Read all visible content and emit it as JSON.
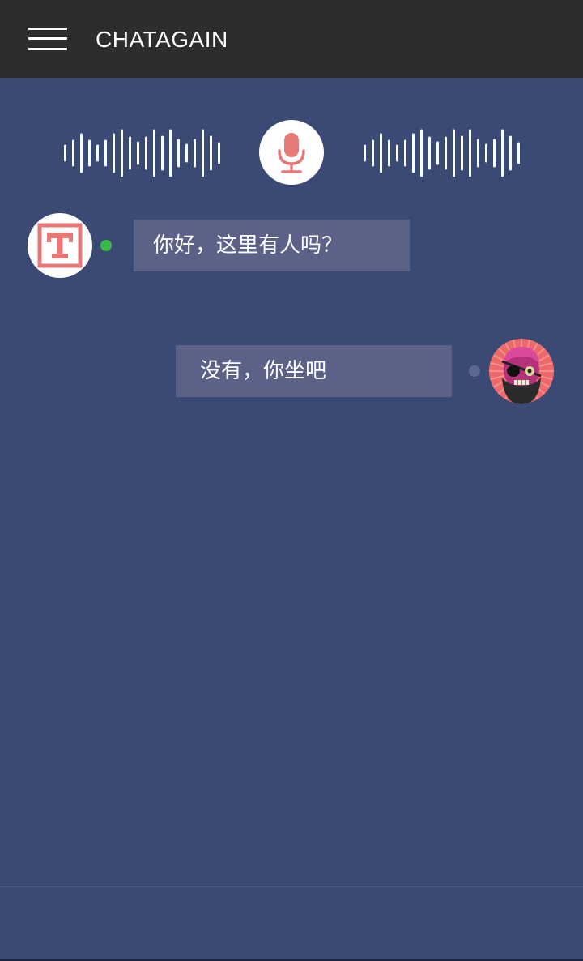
{
  "header": {
    "title": "CHATAGAIN",
    "menu_icon": "hamburger-menu-icon"
  },
  "voice": {
    "mic_icon": "microphone-icon",
    "wave_icon": "sound-wave-icon",
    "accent_color": "#e87878"
  },
  "messages": [
    {
      "side": "left",
      "text": "你好，这里有人吗？",
      "avatar": "typo-logo-avatar",
      "status": "online",
      "status_color": "#3cb84a"
    },
    {
      "side": "right",
      "text": "没有，你坐吧",
      "avatar": "pirate-avatar",
      "status": "offline",
      "status_color": "#5d6790"
    }
  ],
  "colors": {
    "background": "#3a4a74",
    "header": "#2d2d2d",
    "bubble": "#5b6187"
  }
}
